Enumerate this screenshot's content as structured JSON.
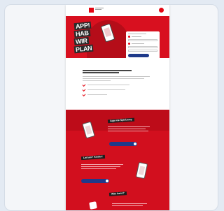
{
  "hero": {
    "title_lines": [
      "APP!",
      "HAB",
      "WIR",
      "PLAN"
    ]
  },
  "sections": {
    "tag_1": "App wie Spielzeug",
    "tag_2": "Lernen? Kinder!",
    "tag_3": "Was kann?"
  },
  "colors": {
    "brand_red": "#e30613",
    "section_red": "#d20f1e",
    "button_blue": "#1f3a8a",
    "dark_tag": "#1d1d1d"
  },
  "icons": [
    "logo-icon",
    "menu-icon",
    "check-icon",
    "phone-icon",
    "arrow-icon"
  ]
}
